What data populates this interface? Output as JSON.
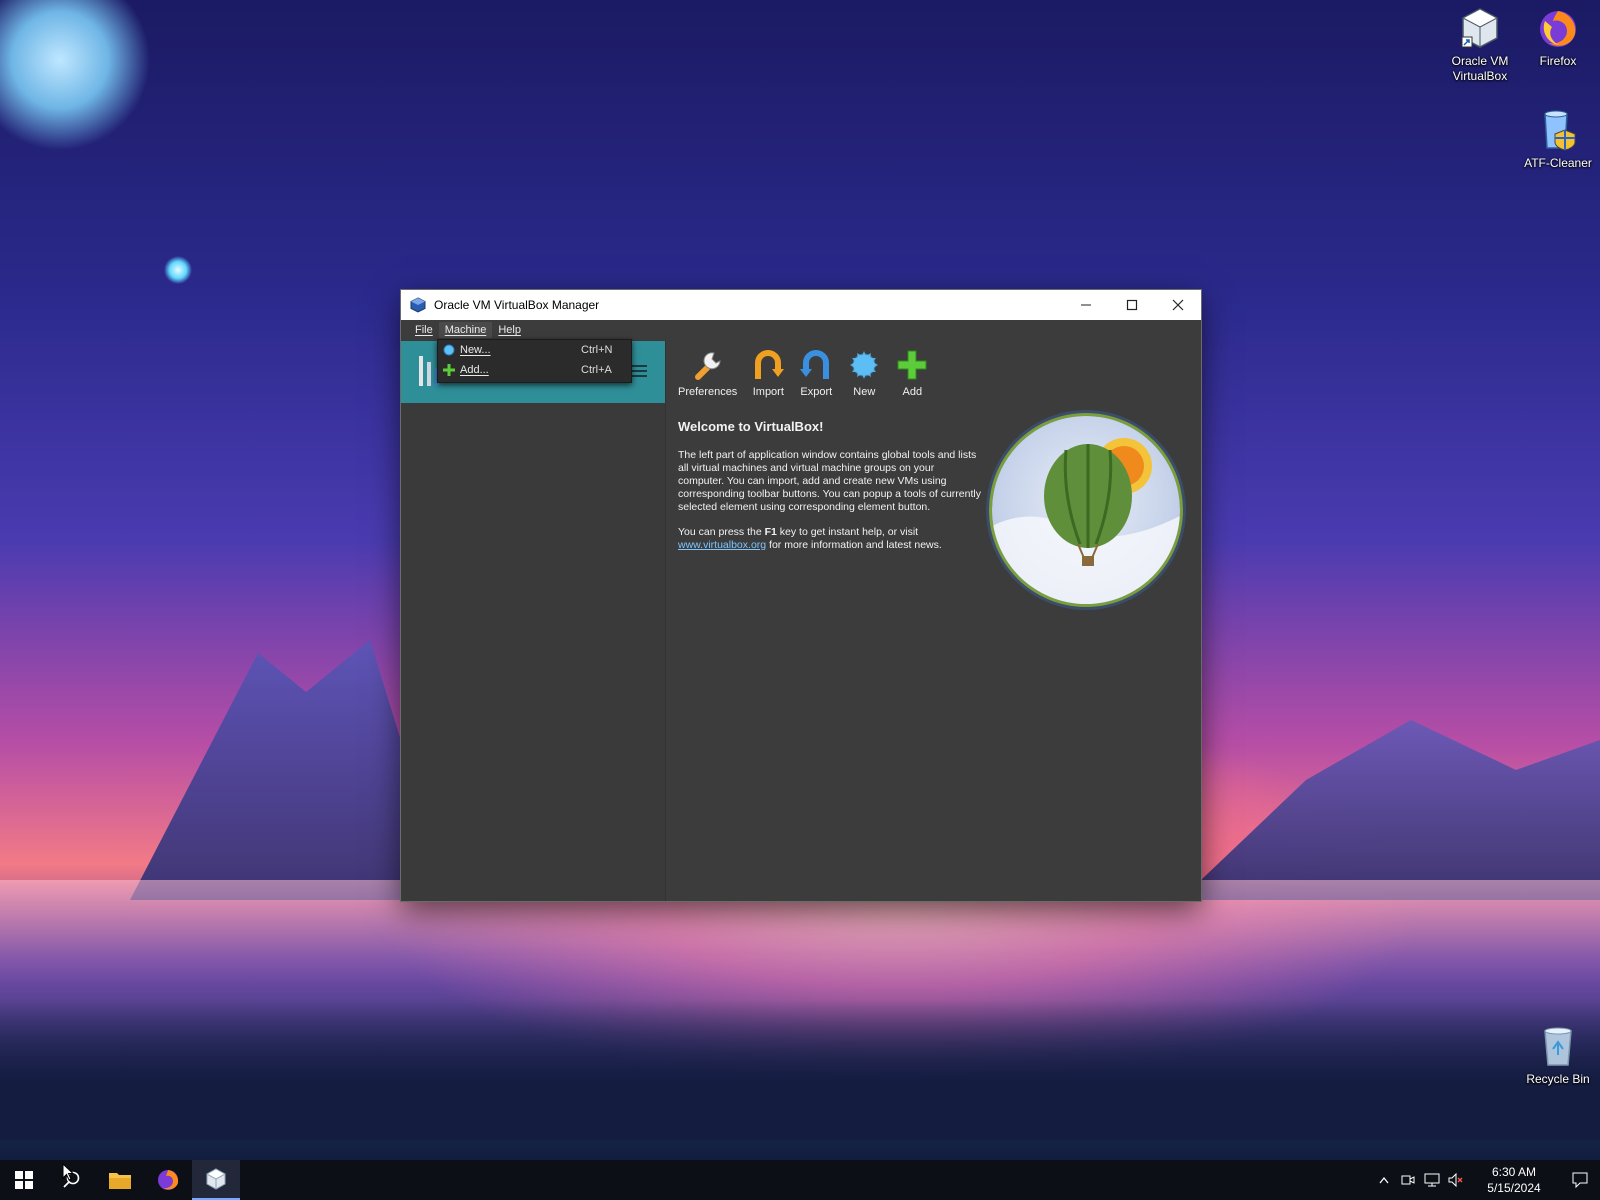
{
  "window": {
    "title": "Oracle VM VirtualBox Manager",
    "menu": {
      "file": "File",
      "machine": "Machine",
      "help": "Help"
    }
  },
  "machine_menu": {
    "items": [
      {
        "label": "New...",
        "shortcut": "Ctrl+N",
        "icon": "new-vm-icon"
      },
      {
        "label": "Add...",
        "shortcut": "Ctrl+A",
        "icon": "add-icon"
      }
    ]
  },
  "toolbar": {
    "preferences": "Preferences",
    "import": "Import",
    "export": "Export",
    "new": "New",
    "add": "Add"
  },
  "welcome": {
    "heading": "Welcome to VirtualBox!",
    "para1": "The left part of application window contains global tools and lists all virtual machines and virtual machine groups on your computer. You can import, add and create new VMs using corresponding toolbar buttons. You can popup a tools of currently selected element using corresponding element button.",
    "para2_pre": "You can press the ",
    "para2_key": "F1",
    "para2_mid": " key to get instant help, or visit ",
    "link": "www.virtualbox.org",
    "para2_post": " for more information and latest news."
  },
  "desktop_icons": [
    {
      "label1": "Oracle VM",
      "label2": "VirtualBox",
      "icon": "virtualbox-icon"
    },
    {
      "label1": "Firefox",
      "label2": "",
      "icon": "firefox-icon"
    },
    {
      "label1": "ATF-Cleaner",
      "label2": "",
      "icon": "atf-cleaner-icon"
    },
    {
      "label1": "Recycle Bin",
      "label2": "",
      "icon": "recycle-bin-icon"
    }
  ],
  "taskbar": {
    "time": "6:30 AM",
    "date": "5/15/2024"
  },
  "colors": {
    "tools_highlight": "#2f8f99",
    "window_bg": "#3c3c3c",
    "link": "#7fc6ff"
  }
}
